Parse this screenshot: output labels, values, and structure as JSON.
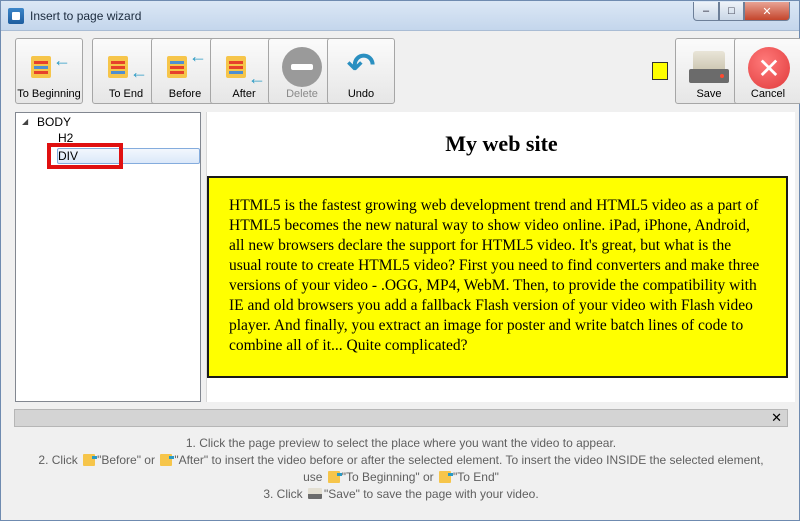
{
  "window": {
    "title": "Insert to page wizard",
    "minimize": "‒",
    "maximize": "□",
    "close": "✕"
  },
  "toolbar": {
    "to_beginning": "To Beginning",
    "to_end": "To End",
    "before": "Before",
    "after": "After",
    "delete": "Delete",
    "undo": "Undo",
    "save": "Save",
    "cancel": "Cancel",
    "color_swatch": "#ffff00"
  },
  "tree": {
    "nodes": [
      "BODY",
      "H2",
      "DIV"
    ],
    "expand_glyph": "◢"
  },
  "preview": {
    "heading": "My web site",
    "paragraph": "HTML5 is the fastest growing web development trend and HTML5 video as a part of HTML5 becomes the new natural way to show video online. iPad, iPhone, Android, all new browsers declare the support for HTML5 video. It's great, but what is the usual route to create HTML5 video? First you need to find converters and make three versions of your video - .OGG, MP4, WebM. Then, to provide the compatibility with IE and old browsers you add a fallback Flash version of your video with Flash video player. And finally, you extract an image for poster and write batch lines of code to combine all of it... Quite complicated?"
  },
  "hint": {
    "close": "✕",
    "line1": "1. Click the page preview to select the place where you want the video to appear.",
    "line2_a": "2. Click",
    "line2_b": "\"Before\" or",
    "line2_c": "\"After\" to insert the video before or after the selected element. To insert the video INSIDE the selected element,",
    "line3_a": "use",
    "line3_b": "\"To Beginning\" or",
    "line3_c": "\"To End\"",
    "line4_a": "3. Click",
    "line4_b": "\"Save\" to save the page with your video."
  }
}
